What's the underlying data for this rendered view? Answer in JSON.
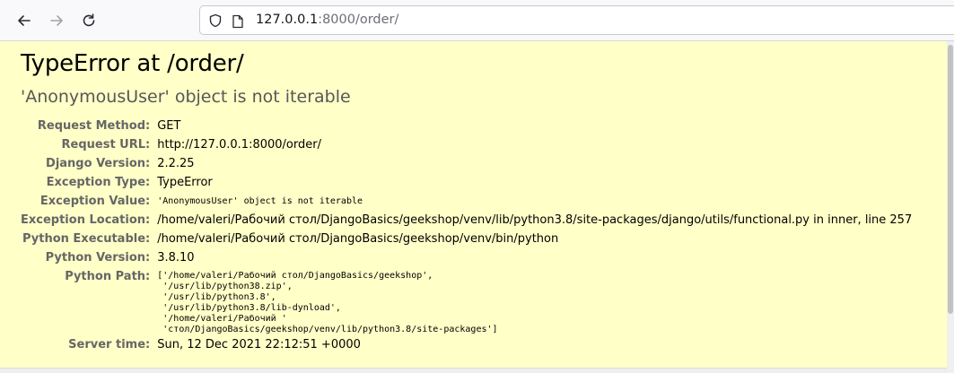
{
  "browser": {
    "url_host": "127.0.0.1",
    "url_rest": ":8000/order/"
  },
  "error": {
    "title": "TypeError at /order/",
    "message": "'AnonymousUser' object is not iterable"
  },
  "meta": {
    "request_method_label": "Request Method:",
    "request_method": "GET",
    "request_url_label": "Request URL:",
    "request_url": "http://127.0.0.1:8000/order/",
    "django_version_label": "Django Version:",
    "django_version": "2.2.25",
    "exception_type_label": "Exception Type:",
    "exception_type": "TypeError",
    "exception_value_label": "Exception Value:",
    "exception_value": "'AnonymousUser' object is not iterable",
    "exception_location_label": "Exception Location:",
    "exception_location": "/home/valeri/Рабочий стол/DjangoBasics/geekshop/venv/lib/python3.8/site-packages/django/utils/functional.py in inner, line 257",
    "python_executable_label": "Python Executable:",
    "python_executable": "/home/valeri/Рабочий стол/DjangoBasics/geekshop/venv/bin/python",
    "python_version_label": "Python Version:",
    "python_version": "3.8.10",
    "python_path_label": "Python Path:",
    "python_path": "['/home/valeri/Рабочий стол/DjangoBasics/geekshop',\n '/usr/lib/python38.zip',\n '/usr/lib/python3.8',\n '/usr/lib/python3.8/lib-dynload',\n '/home/valeri/Рабочий '\n 'стол/DjangoBasics/geekshop/venv/lib/python3.8/site-packages']",
    "server_time_label": "Server time:",
    "server_time": "Sun, 12 Dec 2021 22:12:51 +0000"
  }
}
